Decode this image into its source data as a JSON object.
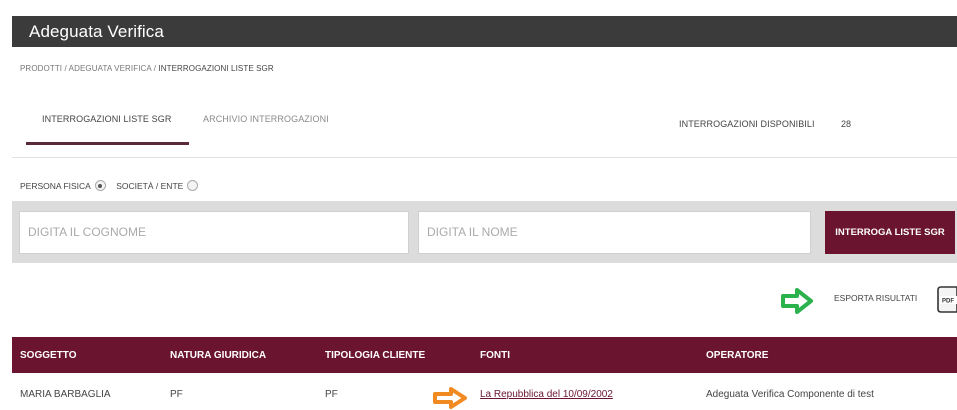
{
  "app": {
    "title": "Adeguata Verifica"
  },
  "breadcrumb": {
    "items": [
      "PRODOTTI",
      "ADEGUATA VERIFICA",
      "INTERROGAZIONI LISTE SGR"
    ],
    "sep": " / "
  },
  "tabs": [
    {
      "label": "INTERROGAZIONI LISTE SGR",
      "active": true
    },
    {
      "label": "ARCHIVIO INTERROGAZIONI",
      "active": false
    }
  ],
  "availability": {
    "label": "INTERROGAZIONI DISPONIBILI",
    "count": "28"
  },
  "type_selector": {
    "options": [
      {
        "label": "PERSONA FISICA",
        "checked": true
      },
      {
        "label": "SOCIETÀ / ENTE",
        "checked": false
      }
    ]
  },
  "search": {
    "surname_placeholder": "DIGITA IL COGNOME",
    "name_placeholder": "DIGITA IL NOME",
    "button_label": "INTERROGA LISTE SGR"
  },
  "export": {
    "label": "ESPORTA RISULTATI",
    "icon": "pdf-icon",
    "arrow_color": "#2bb24c"
  },
  "table": {
    "headers": [
      "SOGGETTO",
      "NATURA GIURIDICA",
      "TIPOLOGIA CLIENTE",
      "FONTI",
      "OPERATORE"
    ],
    "rows": [
      [
        "MARIA BARBAGLIA",
        "PF",
        "PF",
        "La Repubblica del 10/09/2002",
        "Adeguata Verifica Componente di test"
      ]
    ]
  },
  "colors": {
    "brand": "#6a1430",
    "title_bar": "#3b3b3b",
    "highlight_arrow": "#f28a22"
  }
}
